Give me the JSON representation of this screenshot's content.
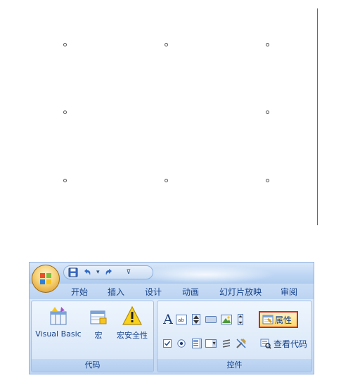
{
  "ribbon": {
    "tabs": [
      "开始",
      "插入",
      "设计",
      "动画",
      "幻灯片放映",
      "审阅"
    ],
    "groups": {
      "code": {
        "label": "代码",
        "visual_basic": "Visual Basic",
        "macro": "宏",
        "macro_security": "宏安全性"
      },
      "controls": {
        "label": "控件",
        "properties": "属性",
        "view_code": "查看代码"
      }
    },
    "colors": {
      "accent": "#15428b",
      "highlight_border": "#e02020",
      "ribbon_bg": "#bfdbff"
    }
  }
}
